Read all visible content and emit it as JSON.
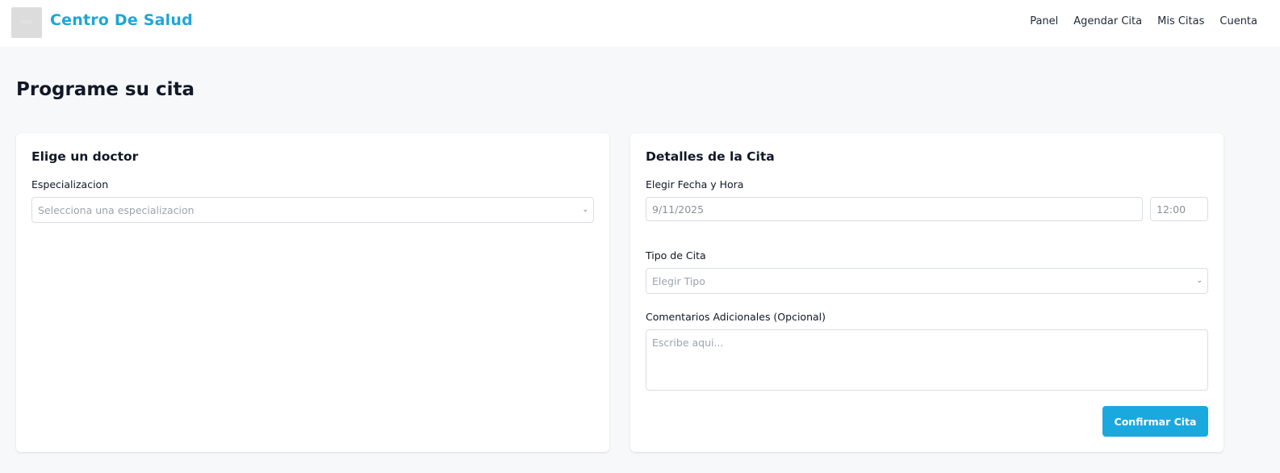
{
  "header": {
    "logo_text": "LOGO",
    "brand": "Centro De Salud",
    "nav": [
      "Panel",
      "Agendar Cita",
      "Mis Citas",
      "Cuenta"
    ]
  },
  "page": {
    "title": "Programe su cita"
  },
  "doctor_card": {
    "title": "Elige un doctor",
    "specialization_label": "Especializacion",
    "specialization_placeholder": "Selecciona una especializacion"
  },
  "details_card": {
    "title": "Detalles de la Cita",
    "datetime_label": "Elegir Fecha y Hora",
    "date_value": "9/11/2025",
    "time_value": "12:00",
    "type_label": "Tipo de Cita",
    "type_placeholder": "Elegir Tipo",
    "comments_label": "Comentarios Adicionales (Opcional)",
    "comments_placeholder": "Escribe aqui...",
    "confirm_button": "Confirmar Cita"
  },
  "colors": {
    "accent": "#1aa9df",
    "brand": "#1ea6d6",
    "background": "#f7f8fa"
  },
  "icons": {
    "select_chevron": "chevron-down-icon"
  }
}
